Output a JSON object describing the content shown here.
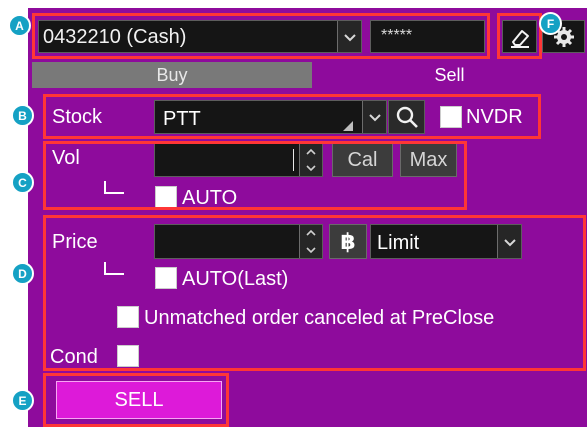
{
  "markers": {
    "a": "A",
    "b": "B",
    "c": "C",
    "d": "D",
    "e": "E",
    "f": "F"
  },
  "account": {
    "selected": "0432210 (Cash)",
    "pin": "*****"
  },
  "tabs": {
    "buy": "Buy",
    "sell": "Sell",
    "active": "Sell"
  },
  "stock": {
    "label": "Stock",
    "value": "PTT",
    "nvdr_label": "NVDR"
  },
  "volume": {
    "label": "Vol",
    "value": "",
    "cal_button": "Cal",
    "max_button": "Max",
    "auto_label": "AUTO"
  },
  "price": {
    "label": "Price",
    "value": "",
    "currency_symbol": "฿",
    "type_selected": "Limit",
    "auto_label": "AUTO(Last)"
  },
  "unmatched": {
    "label": "Unmatched order canceled at PreClose"
  },
  "cond": {
    "label": "Cond"
  },
  "submit": {
    "label": "SELL"
  },
  "colors": {
    "panel_bg": "#8e0b9c",
    "highlight_border": "#ff3636",
    "sell_button": "#dd1ad9",
    "marker": "#15a1c4",
    "input_bg": "#151515"
  },
  "icons": [
    "chevron-down-icon",
    "eraser-icon",
    "settings-icon",
    "search-icon",
    "spin-up-icon",
    "spin-down-icon",
    "baht-icon"
  ]
}
